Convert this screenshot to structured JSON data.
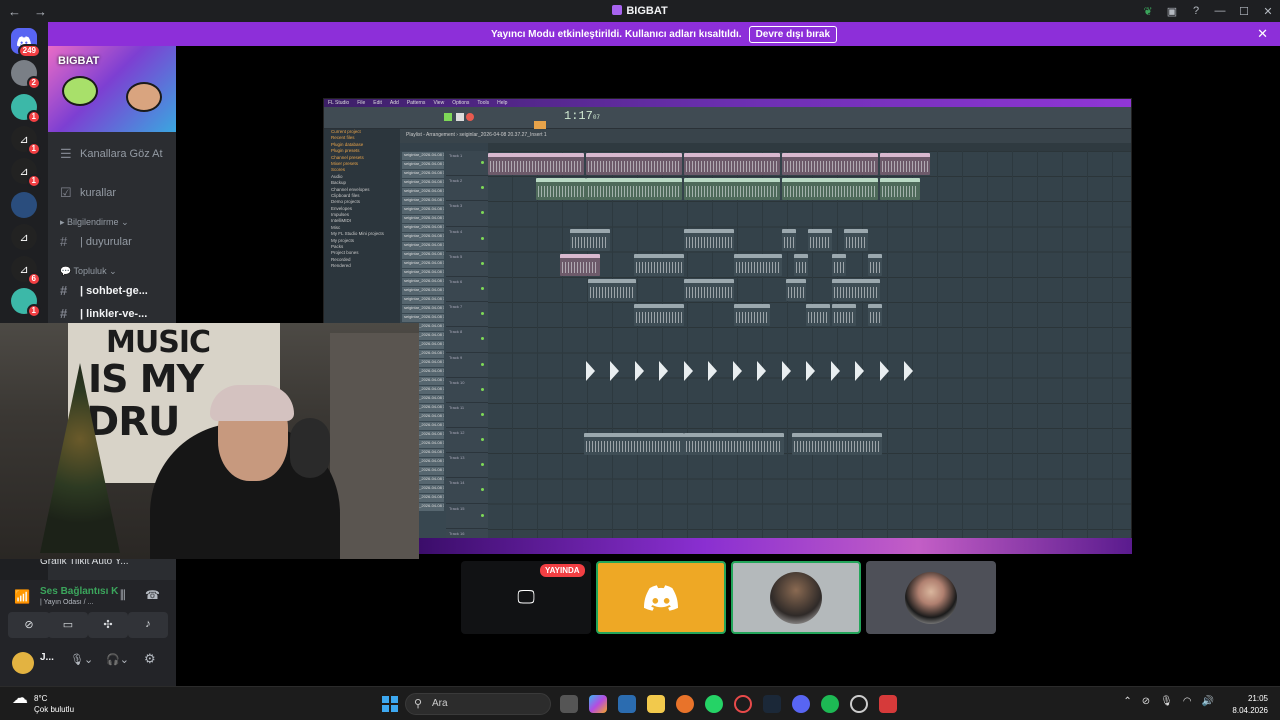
{
  "window": {
    "title": "BIGBAT",
    "back": "←",
    "forward": "→"
  },
  "banner": {
    "message": "Yayıncı Modu etkinleştirildi. Kullanıcı adları kısaltıldı.",
    "button": "Devre dışı bırak",
    "close": "✕"
  },
  "servers": {
    "home_badge": "249",
    "badges": [
      "2",
      "1",
      "1",
      "1",
      "1",
      "6",
      "1"
    ]
  },
  "server": {
    "name": "BIGBAT"
  },
  "channels": {
    "items": [
      {
        "label": "Kanallara Göz At"
      },
      {
        "label": "kurallar"
      }
    ],
    "category_info": "Bilgilendirme",
    "duyurular": "| duyurular",
    "category_community": "Topluluk",
    "sohbet": "| sohbet-ge...",
    "linkler": "| linkler-ve-..."
  },
  "voice": {
    "partial_label": "Grafik Tilkit Auto Y...",
    "status": "Ses Bağlantısı K",
    "room": "| Yayın Odası / ...",
    "user": "J..."
  },
  "fl": {
    "app": "FL Studio",
    "menu": [
      "File",
      "Edit",
      "Add",
      "Patterns",
      "View",
      "Options",
      "Tools",
      "Help"
    ],
    "time": "1:17",
    "time_sub": "07",
    "pattern": "Playlist - Arrangement › seiginlar_2026-04-08 20.37.27_Insert 1",
    "browser": [
      "Current project",
      "Recent files",
      "Plugin database",
      "Plugin presets",
      "Channel presets",
      "Mixer presets",
      "Scores",
      "Audio",
      "Backup",
      "Channel envelopes",
      "Clipboard files",
      "Demo projects",
      "Envelopes",
      "Impulses",
      "IntelliMIDI",
      "Misc",
      "My FL Studio Mini projects",
      "My projects",
      "Packs",
      "Project bones",
      "Recorded",
      "Rendered"
    ],
    "channel_label": "seigintar_2026-04-08 1",
    "tracks": [
      "Track 1",
      "Track 2",
      "Track 3",
      "Track 4",
      "Track 5",
      "Track 6",
      "Track 7",
      "Track 8",
      "Track 9",
      "Track 10",
      "Track 11",
      "Track 12",
      "Track 13",
      "Track 14",
      "Track 15",
      "Track 16"
    ]
  },
  "stream": {
    "live_label": "YAYINDA"
  },
  "taskbar": {
    "temp": "8°C",
    "weather": "Çok bulutlu",
    "search": "Ara",
    "time": "21:05",
    "date": "8.04.2026"
  }
}
